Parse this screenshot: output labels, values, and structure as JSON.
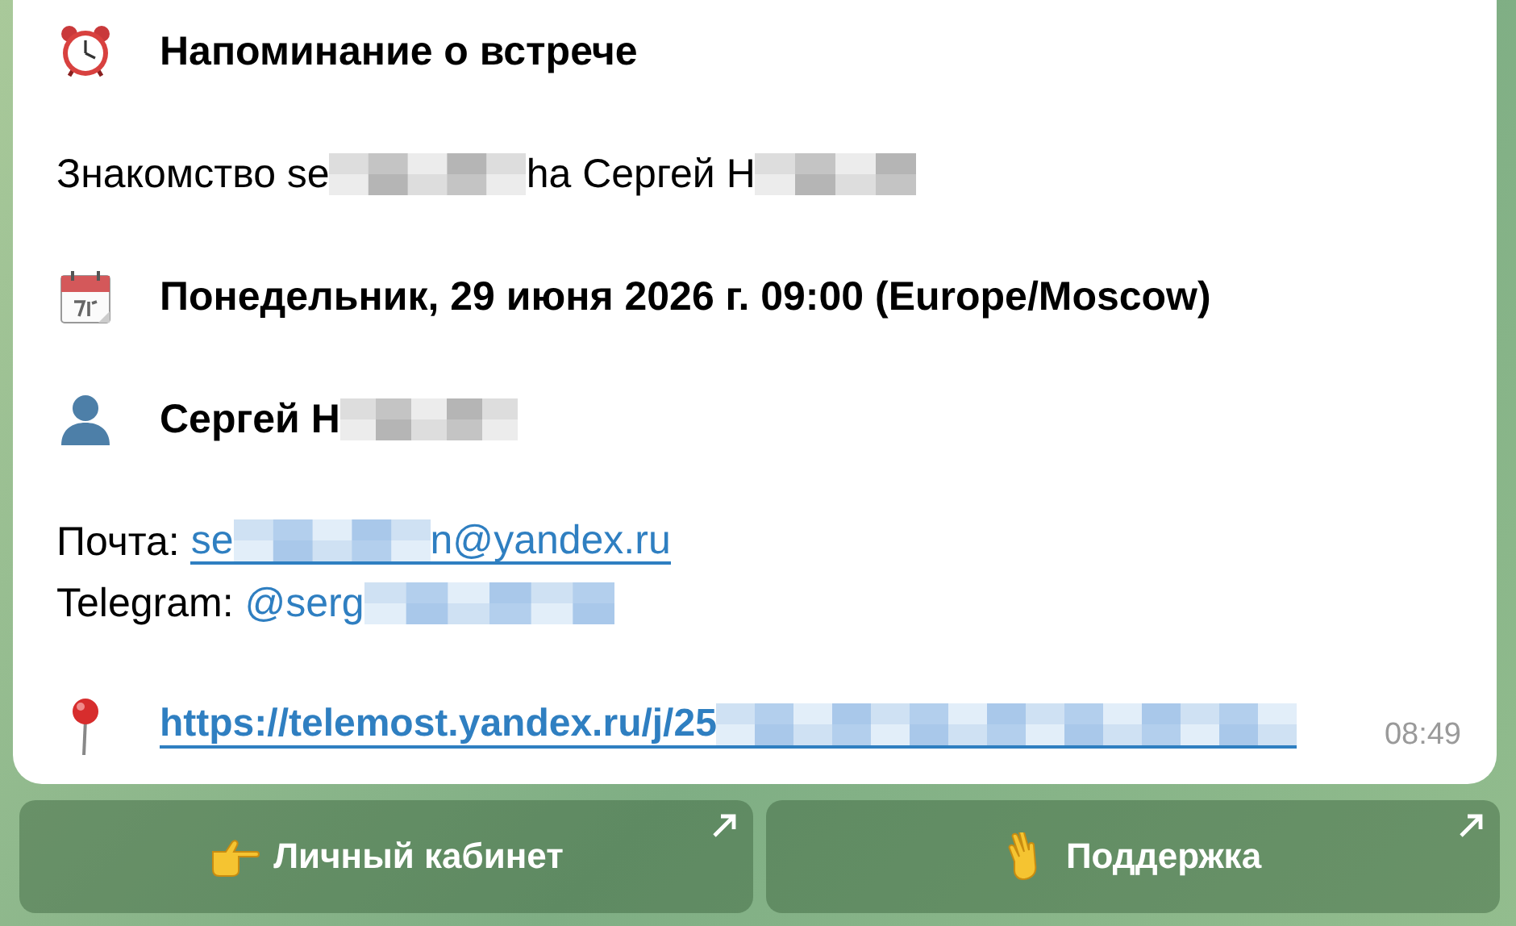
{
  "message": {
    "title": "Напоминание о встрече",
    "subject": [
      {
        "kind": "text",
        "text": "Знакомство se"
      },
      {
        "kind": "redacted"
      },
      {
        "kind": "text",
        "text": "ha Сергей Н"
      },
      {
        "kind": "redacted"
      }
    ],
    "date": "Понедельник, 29 июня 2026 г. 09:00 (Europe/Moscow)",
    "person": [
      {
        "kind": "text",
        "text": "Сергей Н"
      },
      {
        "kind": "redacted"
      }
    ],
    "contacts": [
      {
        "label": "Почта:",
        "value": [
          {
            "kind": "text",
            "text": "se"
          },
          {
            "kind": "redacted"
          },
          {
            "kind": "text",
            "text": "n@yandex.ru"
          }
        ],
        "underlined": true
      },
      {
        "label": "Telegram:",
        "value": [
          {
            "kind": "text",
            "text": "@serg"
          },
          {
            "kind": "redacted"
          }
        ],
        "underlined": false
      }
    ],
    "link": [
      {
        "kind": "text",
        "text": "https://telemost.yandex.ru/j/25"
      },
      {
        "kind": "redacted"
      }
    ],
    "time": "08:49"
  },
  "buttons": [
    {
      "label": "Личный кабинет"
    },
    {
      "label": "Поддержка"
    }
  ]
}
